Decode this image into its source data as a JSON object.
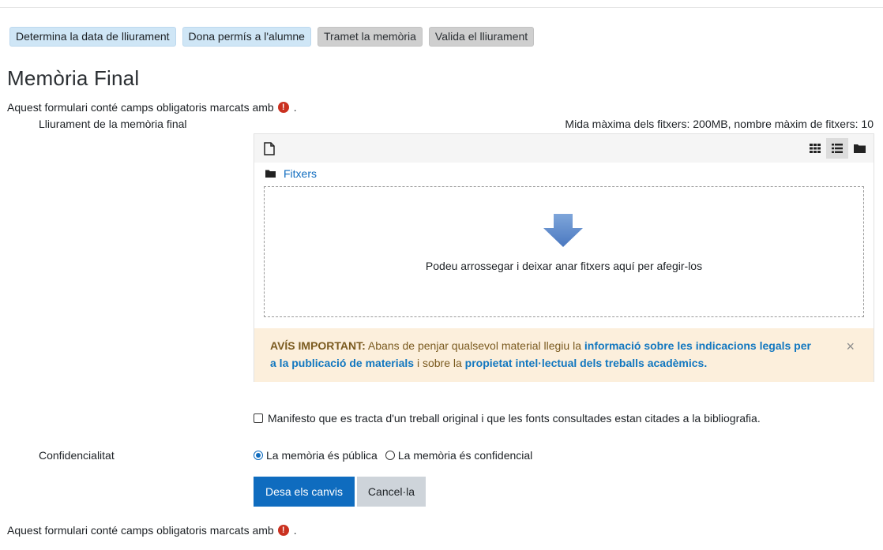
{
  "steps": [
    {
      "label": "Determina la data de lliurament",
      "state": "active"
    },
    {
      "label": "Dona permís a l'alumne",
      "state": "active"
    },
    {
      "label": "Tramet la memòria",
      "state": "inactive"
    },
    {
      "label": "Valida el lliurament",
      "state": "inactive"
    }
  ],
  "page_title": "Memòria Final",
  "required_note": {
    "text": "Aquest formulari conté camps obligatoris marcats amb",
    "suffix": ".",
    "icon": "!"
  },
  "upload": {
    "label": "Lliurament de la memòria final",
    "limits": "Mida màxima dels fitxers: 200MB, nombre màxim de fitxers: 10",
    "folder_label": "Fitxers",
    "drop_text": "Podeu arrossegar i deixar anar fitxers aquí per afegir-los"
  },
  "alert": {
    "strong": "AVÍS IMPORTANT:",
    "text1": " Abans de penjar qualsevol material llegiu la ",
    "link1": "informació sobre les indicacions legals per a la publicació de materials",
    "text2": " i sobre la ",
    "link2": "propietat intel·lectual dels treballs acadèmics.",
    "close": "×"
  },
  "originality_checkbox": "Manifesto que es tracta d'un treball original i que les fonts consultades estan citades a la bibliografia.",
  "confidentiality": {
    "label": "Confidencialitat",
    "options": [
      {
        "label": "La memòria és pública",
        "selected": true
      },
      {
        "label": "La memòria és confidencial",
        "selected": false
      }
    ]
  },
  "buttons": {
    "save": "Desa els canvis",
    "cancel": "Cancel·la"
  },
  "colors": {
    "primary": "#0f6cbf",
    "required": "#ca3120",
    "alert_bg": "#fcefdc",
    "step_active": "#cfe6f6"
  }
}
